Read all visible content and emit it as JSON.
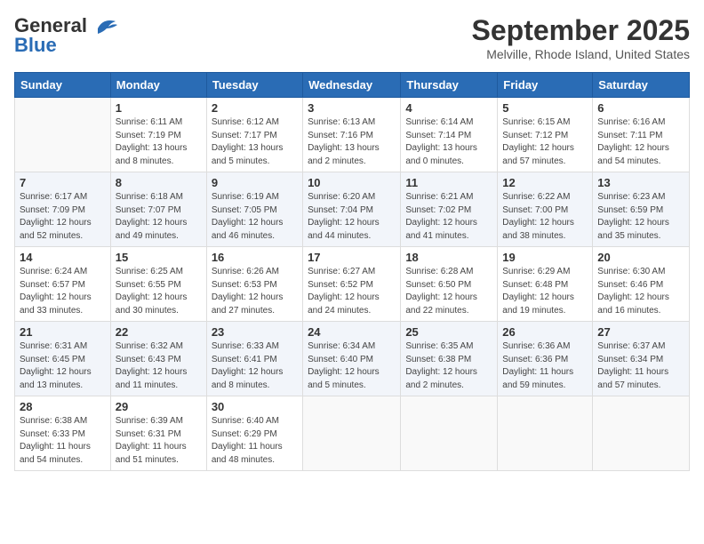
{
  "logo": {
    "line1": "General",
    "line2": "Blue"
  },
  "title": "September 2025",
  "location": "Melville, Rhode Island, United States",
  "weekdays": [
    "Sunday",
    "Monday",
    "Tuesday",
    "Wednesday",
    "Thursday",
    "Friday",
    "Saturday"
  ],
  "weeks": [
    [
      {
        "day": "",
        "info": ""
      },
      {
        "day": "1",
        "info": "Sunrise: 6:11 AM\nSunset: 7:19 PM\nDaylight: 13 hours\nand 8 minutes."
      },
      {
        "day": "2",
        "info": "Sunrise: 6:12 AM\nSunset: 7:17 PM\nDaylight: 13 hours\nand 5 minutes."
      },
      {
        "day": "3",
        "info": "Sunrise: 6:13 AM\nSunset: 7:16 PM\nDaylight: 13 hours\nand 2 minutes."
      },
      {
        "day": "4",
        "info": "Sunrise: 6:14 AM\nSunset: 7:14 PM\nDaylight: 13 hours\nand 0 minutes."
      },
      {
        "day": "5",
        "info": "Sunrise: 6:15 AM\nSunset: 7:12 PM\nDaylight: 12 hours\nand 57 minutes."
      },
      {
        "day": "6",
        "info": "Sunrise: 6:16 AM\nSunset: 7:11 PM\nDaylight: 12 hours\nand 54 minutes."
      }
    ],
    [
      {
        "day": "7",
        "info": "Sunrise: 6:17 AM\nSunset: 7:09 PM\nDaylight: 12 hours\nand 52 minutes."
      },
      {
        "day": "8",
        "info": "Sunrise: 6:18 AM\nSunset: 7:07 PM\nDaylight: 12 hours\nand 49 minutes."
      },
      {
        "day": "9",
        "info": "Sunrise: 6:19 AM\nSunset: 7:05 PM\nDaylight: 12 hours\nand 46 minutes."
      },
      {
        "day": "10",
        "info": "Sunrise: 6:20 AM\nSunset: 7:04 PM\nDaylight: 12 hours\nand 44 minutes."
      },
      {
        "day": "11",
        "info": "Sunrise: 6:21 AM\nSunset: 7:02 PM\nDaylight: 12 hours\nand 41 minutes."
      },
      {
        "day": "12",
        "info": "Sunrise: 6:22 AM\nSunset: 7:00 PM\nDaylight: 12 hours\nand 38 minutes."
      },
      {
        "day": "13",
        "info": "Sunrise: 6:23 AM\nSunset: 6:59 PM\nDaylight: 12 hours\nand 35 minutes."
      }
    ],
    [
      {
        "day": "14",
        "info": "Sunrise: 6:24 AM\nSunset: 6:57 PM\nDaylight: 12 hours\nand 33 minutes."
      },
      {
        "day": "15",
        "info": "Sunrise: 6:25 AM\nSunset: 6:55 PM\nDaylight: 12 hours\nand 30 minutes."
      },
      {
        "day": "16",
        "info": "Sunrise: 6:26 AM\nSunset: 6:53 PM\nDaylight: 12 hours\nand 27 minutes."
      },
      {
        "day": "17",
        "info": "Sunrise: 6:27 AM\nSunset: 6:52 PM\nDaylight: 12 hours\nand 24 minutes."
      },
      {
        "day": "18",
        "info": "Sunrise: 6:28 AM\nSunset: 6:50 PM\nDaylight: 12 hours\nand 22 minutes."
      },
      {
        "day": "19",
        "info": "Sunrise: 6:29 AM\nSunset: 6:48 PM\nDaylight: 12 hours\nand 19 minutes."
      },
      {
        "day": "20",
        "info": "Sunrise: 6:30 AM\nSunset: 6:46 PM\nDaylight: 12 hours\nand 16 minutes."
      }
    ],
    [
      {
        "day": "21",
        "info": "Sunrise: 6:31 AM\nSunset: 6:45 PM\nDaylight: 12 hours\nand 13 minutes."
      },
      {
        "day": "22",
        "info": "Sunrise: 6:32 AM\nSunset: 6:43 PM\nDaylight: 12 hours\nand 11 minutes."
      },
      {
        "day": "23",
        "info": "Sunrise: 6:33 AM\nSunset: 6:41 PM\nDaylight: 12 hours\nand 8 minutes."
      },
      {
        "day": "24",
        "info": "Sunrise: 6:34 AM\nSunset: 6:40 PM\nDaylight: 12 hours\nand 5 minutes."
      },
      {
        "day": "25",
        "info": "Sunrise: 6:35 AM\nSunset: 6:38 PM\nDaylight: 12 hours\nand 2 minutes."
      },
      {
        "day": "26",
        "info": "Sunrise: 6:36 AM\nSunset: 6:36 PM\nDaylight: 11 hours\nand 59 minutes."
      },
      {
        "day": "27",
        "info": "Sunrise: 6:37 AM\nSunset: 6:34 PM\nDaylight: 11 hours\nand 57 minutes."
      }
    ],
    [
      {
        "day": "28",
        "info": "Sunrise: 6:38 AM\nSunset: 6:33 PM\nDaylight: 11 hours\nand 54 minutes."
      },
      {
        "day": "29",
        "info": "Sunrise: 6:39 AM\nSunset: 6:31 PM\nDaylight: 11 hours\nand 51 minutes."
      },
      {
        "day": "30",
        "info": "Sunrise: 6:40 AM\nSunset: 6:29 PM\nDaylight: 11 hours\nand 48 minutes."
      },
      {
        "day": "",
        "info": ""
      },
      {
        "day": "",
        "info": ""
      },
      {
        "day": "",
        "info": ""
      },
      {
        "day": "",
        "info": ""
      }
    ]
  ]
}
